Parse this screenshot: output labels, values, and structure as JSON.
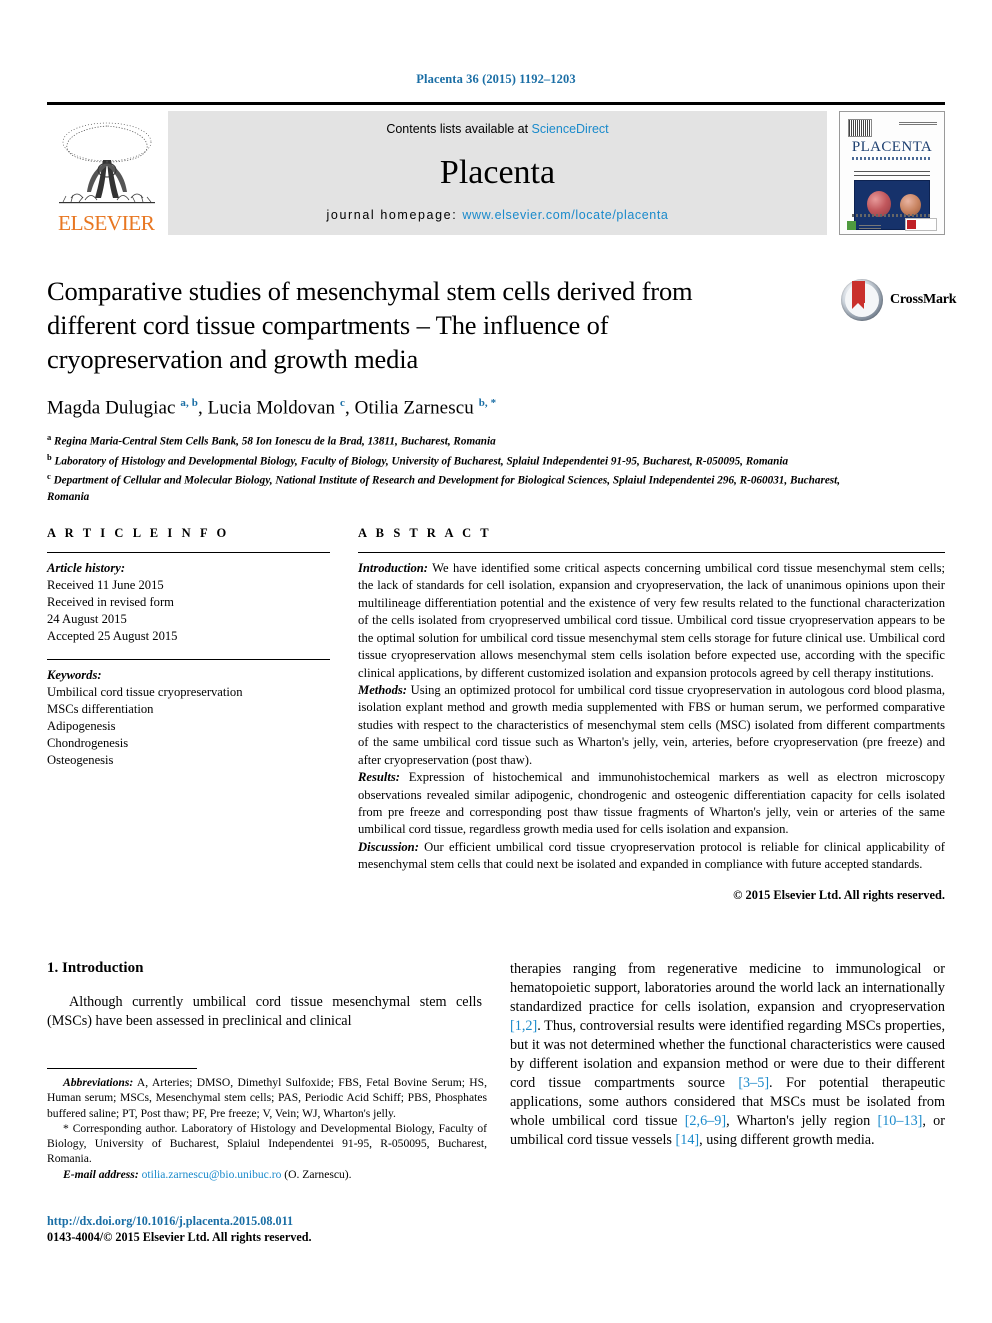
{
  "running_head": "Placenta 36 (2015) 1192–1203",
  "header": {
    "publisher": "ELSEVIER",
    "contents_prefix": "Contents lists available at ",
    "contents_link": "ScienceDirect",
    "journal_title": "Placenta",
    "homepage_prefix": "journal homepage: ",
    "homepage_url": "www.elsevier.com/locate/placenta",
    "cover_title": "PLACENTA"
  },
  "article": {
    "title": "Comparative studies of mesenchymal stem cells derived from different cord tissue compartments – The influence of cryopreservation and growth media",
    "crossmark_label": "CrossMark",
    "authors_html": "Magda Dulugiac <sup>a, b</sup>, Lucia Moldovan <sup>c</sup>, Otilia Zarnescu <sup>b, *</sup>",
    "affiliations": [
      {
        "marker": "a",
        "text": "Regina Maria-Central Stem Cells Bank, 58 Ion Ionescu de la Brad, 13811, Bucharest, Romania"
      },
      {
        "marker": "b",
        "text": "Laboratory of Histology and Developmental Biology, Faculty of Biology, University of Bucharest, Splaiul Independentei 91-95, Bucharest, R-050095, Romania"
      },
      {
        "marker": "c",
        "text": "Department of Cellular and Molecular Biology, National Institute of Research and Development for Biological Sciences, Splaiul Independentei 296, R-060031, Bucharest, Romania"
      }
    ]
  },
  "article_info": {
    "heading": "A R T I C L E  I N F O",
    "history_label": "Article history:",
    "history_lines": [
      "Received 11 June 2015",
      "Received in revised form",
      "24 August 2015",
      "Accepted 25 August 2015"
    ],
    "keywords_label": "Keywords:",
    "keywords": [
      "Umbilical cord tissue cryopreservation",
      "MSCs differentiation",
      "Adipogenesis",
      "Chondrogenesis",
      "Osteogenesis"
    ]
  },
  "abstract": {
    "heading": "A B S T R A C T",
    "sections": [
      {
        "label": "Introduction:",
        "text": " We have identified some critical aspects concerning umbilical cord tissue mesenchymal stem cells; the lack of standards for cell isolation, expansion and cryopreservation, the lack of unanimous opinions upon their multilineage differentiation potential and the existence of very few results related to the functional characterization of the cells isolated from cryopreserved umbilical cord tissue. Umbilical cord tissue cryopreservation appears to be the optimal solution for umbilical cord tissue mesenchymal stem cells storage for future clinical use. Umbilical cord tissue cryopreservation allows mesenchymal stem cells isolation before expected use, according with the specific clinical applications, by different customized isolation and expansion protocols agreed by cell therapy institutions."
      },
      {
        "label": "Methods:",
        "text": " Using an optimized protocol for umbilical cord tissue cryopreservation in autologous cord blood plasma, isolation explant method and growth media supplemented with FBS or human serum, we performed comparative studies with respect to the characteristics of mesenchymal stem cells (MSC) isolated from different compartments of the same umbilical cord tissue such as Wharton's jelly, vein, arteries, before cryopreservation (pre freeze) and after cryopreservation (post thaw)."
      },
      {
        "label": "Results:",
        "text": " Expression of histochemical and immunohistochemical markers as well as electron microscopy observations revealed similar adipogenic, chondrogenic and osteogenic differentiation capacity for cells isolated from pre freeze and corresponding post thaw tissue fragments of Wharton's jelly, vein or arteries of the same umbilical cord tissue, regardless growth media used for cells isolation and expansion."
      },
      {
        "label": "Discussion:",
        "text": " Our efficient umbilical cord tissue cryopreservation protocol is reliable for clinical applicability of mesenchymal stem cells that could next be isolated and expanded in compliance with future accepted standards."
      }
    ],
    "copyright": "© 2015 Elsevier Ltd. All rights reserved."
  },
  "introduction": {
    "heading": "1. Introduction",
    "left_paragraph": "Although currently umbilical cord tissue mesenchymal stem cells (MSCs) have been assessed in preclinical and clinical",
    "right_paragraph_parts": [
      {
        "t": "therapies ranging from regenerative medicine to immunological or hematopoietic support, laboratories around the world lack an internationally standardized practice for cells isolation, expansion and cryopreservation "
      },
      {
        "t": "[1,2]",
        "ref": true
      },
      {
        "t": ". Thus, controversial results were identified regarding MSCs properties, but it was not determined whether the functional characteristics were caused by different isolation and expansion method or were due to their different cord tissue compartments source "
      },
      {
        "t": "[3–5]",
        "ref": true
      },
      {
        "t": ". For potential therapeutic applications, some authors considered that MSCs must be isolated from whole umbilical cord tissue "
      },
      {
        "t": "[2,6–9]",
        "ref": true
      },
      {
        "t": ", Wharton's jelly region "
      },
      {
        "t": "[10–13]",
        "ref": true
      },
      {
        "t": ", or umbilical cord tissue vessels "
      },
      {
        "t": "[14]",
        "ref": true
      },
      {
        "t": ", using different growth media."
      }
    ]
  },
  "footnotes": {
    "abbrev_label": "Abbreviations:",
    "abbrev_text": " A, Arteries; DMSO, Dimethyl Sulfoxide; FBS, Fetal Bovine Serum; HS, Human serum; MSCs, Mesenchymal stem cells; PAS, Periodic Acid Schiff; PBS, Phosphates buffered saline; PT, Post thaw; PF, Pre freeze; V, Vein; WJ, Wharton's jelly.",
    "corresponding": "* Corresponding author. Laboratory of Histology and Developmental Biology, Faculty of Biology, University of Bucharest, Splaiul Independentei 91-95, R-050095, Bucharest, Romania.",
    "email_label": "E-mail address:",
    "email": "otilia.zarnescu@bio.unibuc.ro",
    "email_suffix": " (O. Zarnescu)."
  },
  "footer": {
    "doi": "http://dx.doi.org/10.1016/j.placenta.2015.08.011",
    "issn_line": "0143-4004/© 2015 Elsevier Ltd. All rights reserved."
  },
  "colors": {
    "link": "#1a8acb",
    "running_head": "#1a6ea5",
    "elsevier_orange": "#e87722",
    "band_gray": "#e3e3e3",
    "crossmark_red": "#c9302c"
  }
}
